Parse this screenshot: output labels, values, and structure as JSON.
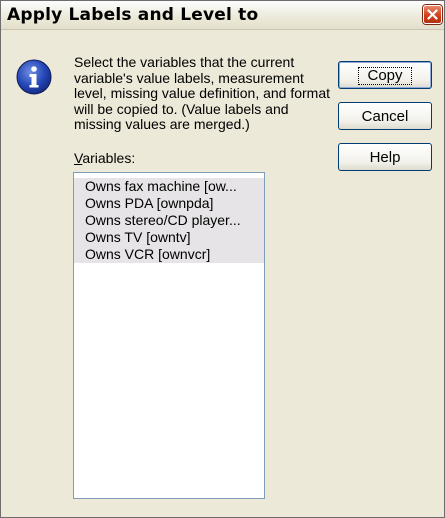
{
  "dialog": {
    "title": "Apply Labels and Level to",
    "message": "Select the variables that the current variable's value labels, measurement level, missing value definition, and format will be copied to.  (Value labels and missing values are merged.)",
    "variables_label_mnemonic": "V",
    "variables_label_rest": "ariables:",
    "icon": "info-icon",
    "close_icon": "close-icon",
    "accent_color": "#d2401c"
  },
  "variables": [
    "Owns fax machine [ow...",
    "Owns PDA [ownpda]",
    "Owns stereo/CD player...",
    "Owns TV [owntv]",
    "Owns VCR [ownvcr]"
  ],
  "buttons": {
    "copy": "Copy",
    "cancel": "Cancel",
    "help": "Help"
  }
}
